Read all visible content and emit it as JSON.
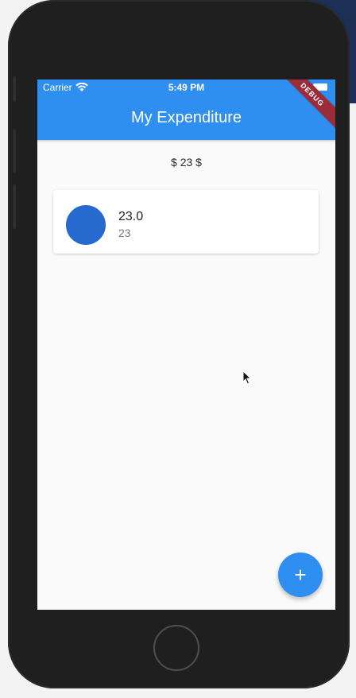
{
  "status_bar": {
    "carrier": "Carrier",
    "time": "5:49 PM",
    "icons": [
      "wifi-icon",
      "battery-icon"
    ]
  },
  "app_bar": {
    "title": "My Expenditure",
    "debug_banner": "DEBUG",
    "color": "#2f8ff1"
  },
  "summary": {
    "total": "$ 23 $"
  },
  "transactions": [
    {
      "title": "23.0",
      "subtitle": "23",
      "avatar_color": "#2669cf"
    }
  ],
  "fab": {
    "icon": "plus-icon",
    "symbol": "+"
  }
}
